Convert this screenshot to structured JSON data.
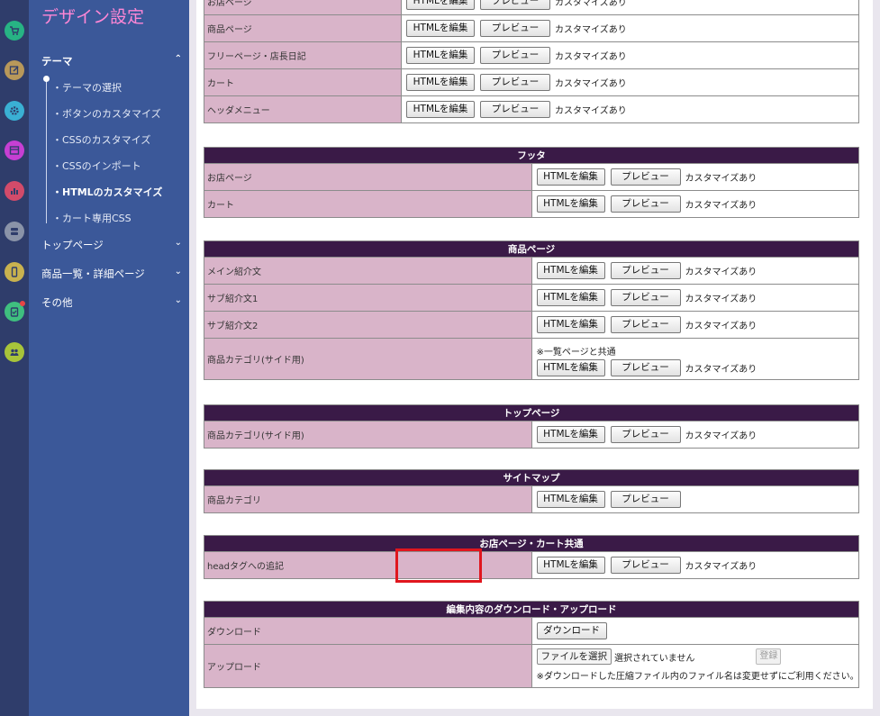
{
  "rail": {
    "icons": [
      {
        "name": "cart-icon",
        "color": "#27b384",
        "glyph": "🛒"
      },
      {
        "name": "edit-icon",
        "color": "#b8985a",
        "glyph": "✎"
      },
      {
        "name": "gear-icon",
        "color": "#3ab0d4",
        "glyph": "⚙"
      },
      {
        "name": "design-icon",
        "color": "#c63fd3",
        "glyph": "▣"
      },
      {
        "name": "chart-icon",
        "color": "#d24b6a",
        "glyph": "▥"
      },
      {
        "name": "server-icon",
        "color": "#8a93a8",
        "glyph": "☰"
      },
      {
        "name": "mobile-icon",
        "color": "#c9b24f",
        "glyph": "▯"
      },
      {
        "name": "clipboard-icon",
        "color": "#3fbf7f",
        "glyph": "✓"
      },
      {
        "name": "users-icon",
        "color": "#a8c43a",
        "glyph": "☺"
      }
    ]
  },
  "sidebar": {
    "title": "デザイン設定",
    "theme": "テーマ",
    "theme_items": [
      "・テーマの選択",
      "・ボタンのカスタマイズ",
      "・CSSのカスタマイズ",
      "・CSSのインポート",
      "・HTMLのカスタマイズ",
      "・カート専用CSS"
    ],
    "top_page": "トップページ",
    "products_page": "商品一覧・詳細ページ",
    "other": "その他"
  },
  "buttons": {
    "edit_html": "HTMLを編集",
    "preview": "プレビュー",
    "download": "ダウンロード",
    "choose_file": "ファイルを選択",
    "register": "登録"
  },
  "custom_label": "カスタマイズあり",
  "top_rows": [
    {
      "label": "お店ページ",
      "custom": true
    },
    {
      "label": "商品ページ",
      "custom": true
    },
    {
      "label": "フリーページ・店長日記",
      "custom": true
    },
    {
      "label": "カート",
      "custom": true
    },
    {
      "label": "ヘッダメニュー",
      "custom": true
    }
  ],
  "sections": {
    "footer": {
      "title": "フッタ",
      "rows": [
        {
          "label": "お店ページ"
        },
        {
          "label": "カート"
        }
      ]
    },
    "product": {
      "title": "商品ページ",
      "rows": [
        {
          "label": "メイン紹介文"
        },
        {
          "label": "サブ紹介文1"
        },
        {
          "label": "サブ紹介文2"
        }
      ],
      "category_label": "商品カテゴリ(サイド用)",
      "category_note": "※一覧ページと共通"
    },
    "top": {
      "title": "トップページ",
      "rows": [
        {
          "label": "商品カテゴリ(サイド用)"
        }
      ]
    },
    "sitemap": {
      "title": "サイトマップ",
      "rows": [
        {
          "label": "商品カテゴリ"
        }
      ]
    },
    "common": {
      "title": "お店ページ・カート共通",
      "rows": [
        {
          "label": "headタグへの追記"
        }
      ]
    },
    "io": {
      "title": "編集内容のダウンロード・アップロード",
      "download_label": "ダウンロード",
      "upload_label": "アップロード",
      "no_file": "選択されていません",
      "upload_note": "※ダウンロードした圧縮ファイル内のファイル名は変更せずにご利用ください。"
    }
  }
}
